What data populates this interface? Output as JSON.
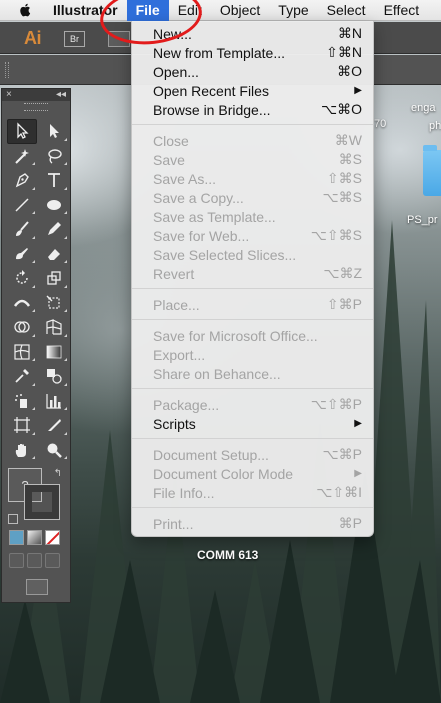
{
  "menubar": {
    "apple_icon": "apple-icon",
    "app_name": "Illustrator",
    "items": [
      "File",
      "Edit",
      "Object",
      "Type",
      "Select",
      "Effect"
    ],
    "active": "File"
  },
  "appbar": {
    "ai_label": "Ai",
    "br_label": "Br"
  },
  "desktop": {
    "label_70": "70",
    "label_eng": "enga",
    "label_ph": "ph",
    "folder_label": "PS_pr",
    "comm_label": "COMM 613"
  },
  "file_menu": {
    "items": [
      {
        "label": "New...",
        "shortcut": "⌘N",
        "enabled": true
      },
      {
        "label": "New from Template...",
        "shortcut": "⇧⌘N",
        "enabled": true
      },
      {
        "label": "Open...",
        "shortcut": "⌘O",
        "enabled": true
      },
      {
        "label": "Open Recent Files",
        "shortcut": "▶",
        "enabled": true
      },
      {
        "label": "Browse in Bridge...",
        "shortcut": "⌥⌘O",
        "enabled": true
      },
      {
        "label": "Close",
        "shortcut": "⌘W",
        "enabled": false
      },
      {
        "label": "Save",
        "shortcut": "⌘S",
        "enabled": false
      },
      {
        "label": "Save As...",
        "shortcut": "⇧⌘S",
        "enabled": false
      },
      {
        "label": "Save a Copy...",
        "shortcut": "⌥⌘S",
        "enabled": false
      },
      {
        "label": "Save as Template...",
        "shortcut": "",
        "enabled": false
      },
      {
        "label": "Save for Web...",
        "shortcut": "⌥⇧⌘S",
        "enabled": false
      },
      {
        "label": "Save Selected Slices...",
        "shortcut": "",
        "enabled": false
      },
      {
        "label": "Revert",
        "shortcut": "⌥⌘Z",
        "enabled": false
      },
      {
        "label": "Place...",
        "shortcut": "⇧⌘P",
        "enabled": false
      },
      {
        "label": "Save for Microsoft Office...",
        "shortcut": "",
        "enabled": false
      },
      {
        "label": "Export...",
        "shortcut": "",
        "enabled": false
      },
      {
        "label": "Share on Behance...",
        "shortcut": "",
        "enabled": false
      },
      {
        "label": "Package...",
        "shortcut": "⌥⇧⌘P",
        "enabled": false
      },
      {
        "label": "Scripts",
        "shortcut": "▶",
        "enabled": true
      },
      {
        "label": "Document Setup...",
        "shortcut": "⌥⌘P",
        "enabled": false
      },
      {
        "label": "Document Color Mode",
        "shortcut": "▶",
        "enabled": false
      },
      {
        "label": "File Info...",
        "shortcut": "⌥⇧⌘I",
        "enabled": false
      },
      {
        "label": "Print...",
        "shortcut": "⌘P",
        "enabled": false
      }
    ]
  },
  "tools_panel": {
    "close_glyph": "×",
    "collapse_glyph": "◂◂",
    "fill_glyph": "?",
    "swap_glyph": "↰",
    "tools": [
      "selection-tool",
      "direct-selection-tool",
      "magic-wand-tool",
      "lasso-tool",
      "pen-tool",
      "type-tool",
      "line-segment-tool",
      "ellipse-tool",
      "paintbrush-tool",
      "pencil-tool",
      "blob-brush-tool",
      "eraser-tool",
      "rotate-tool",
      "scale-tool",
      "width-tool",
      "free-transform-tool",
      "shape-builder-tool",
      "perspective-grid-tool",
      "mesh-tool",
      "gradient-tool",
      "eyedropper-tool",
      "blend-tool",
      "symbol-sprayer-tool",
      "column-graph-tool",
      "artboard-tool",
      "slice-tool",
      "hand-tool",
      "zoom-tool"
    ]
  }
}
